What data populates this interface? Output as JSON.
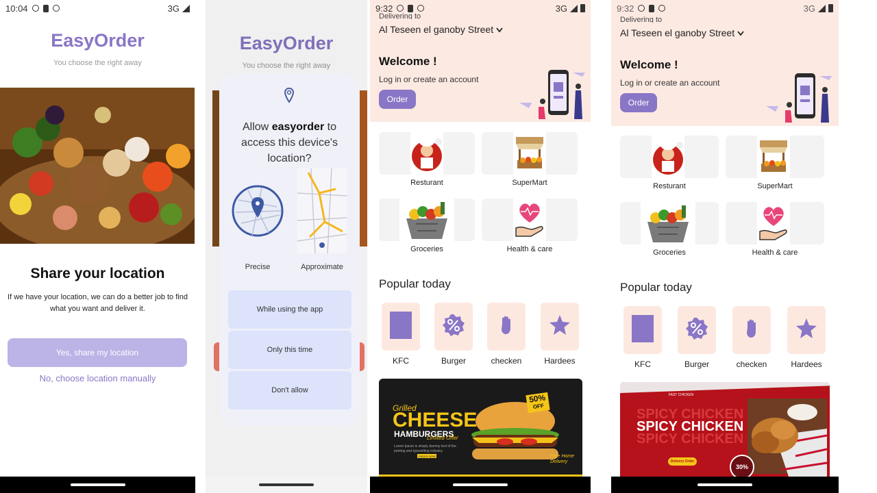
{
  "screen1": {
    "status": {
      "time": "10:04",
      "network": "3G"
    },
    "brand": "EasyOrder",
    "tagline": "You choose the  right away",
    "heading": "Share your location",
    "body": "If we have your location, we can do a better job to find what you want and deliver it.",
    "primary_button": "Yes, share my location",
    "secondary_link": "No, choose location manually"
  },
  "screen2": {
    "brand": "EasyOrder",
    "tagline": "You choose the  right away",
    "dialog": {
      "title_prefix": "Allow ",
      "title_app": "easyorder",
      "title_suffix": " to access this device's location?",
      "precise_label": "Precise",
      "approximate_label": "Approximate",
      "buttons": [
        "While using the app",
        "Only this time",
        "Don't allow"
      ]
    }
  },
  "screen3": {
    "status": {
      "time": "9:32",
      "network": "3G"
    },
    "delivering_label": "Delivering to",
    "address": "Al Teseen el ganoby Street",
    "welcome": "Welcome !",
    "login_text": "Log in or  create an account",
    "order_button": "Order",
    "categories": [
      "Resturant",
      "SuperMart",
      "Groceries",
      "Health & care"
    ],
    "popular_title": "Popular today",
    "popular": [
      "KFC",
      "Burger",
      "checken",
      "Hardees"
    ],
    "banner": {
      "line1": "Grilled",
      "line2": "CHEESE",
      "line3": "HAMBURGERS",
      "line4": "Limited Offer",
      "badge_pct": "50%",
      "badge_off": "OFF",
      "small": "Lorem Ipsum is simply dummy text of the printing and typesetting industry.",
      "order": "ORDER NOW",
      "script": "Free Home Delivery"
    }
  },
  "screen4": {
    "status": {
      "time": "9:32",
      "network": "3G"
    },
    "delivering_label": "Delivering to",
    "address": "Al Teseen el ganoby Street",
    "welcome": "Welcome !",
    "login_text": "Log in or  create an account",
    "order_button": "Order",
    "categories": [
      "Resturant",
      "SuperMart",
      "Groceries",
      "Health & care"
    ],
    "popular_title": "Popular today",
    "popular": [
      "KFC",
      "Burger",
      "checken",
      "Hardees"
    ],
    "banner": {
      "brand": "FAST CHICKEN",
      "headline": "SPICY CHICKEN",
      "delivery": "Delivery Order",
      "pct": "30%"
    }
  },
  "colors": {
    "brand": "#8a76c6",
    "hero_bg": "#fce9e2",
    "tile_bg": "#fde8e0",
    "dialog_btn": "#dce3fb"
  }
}
